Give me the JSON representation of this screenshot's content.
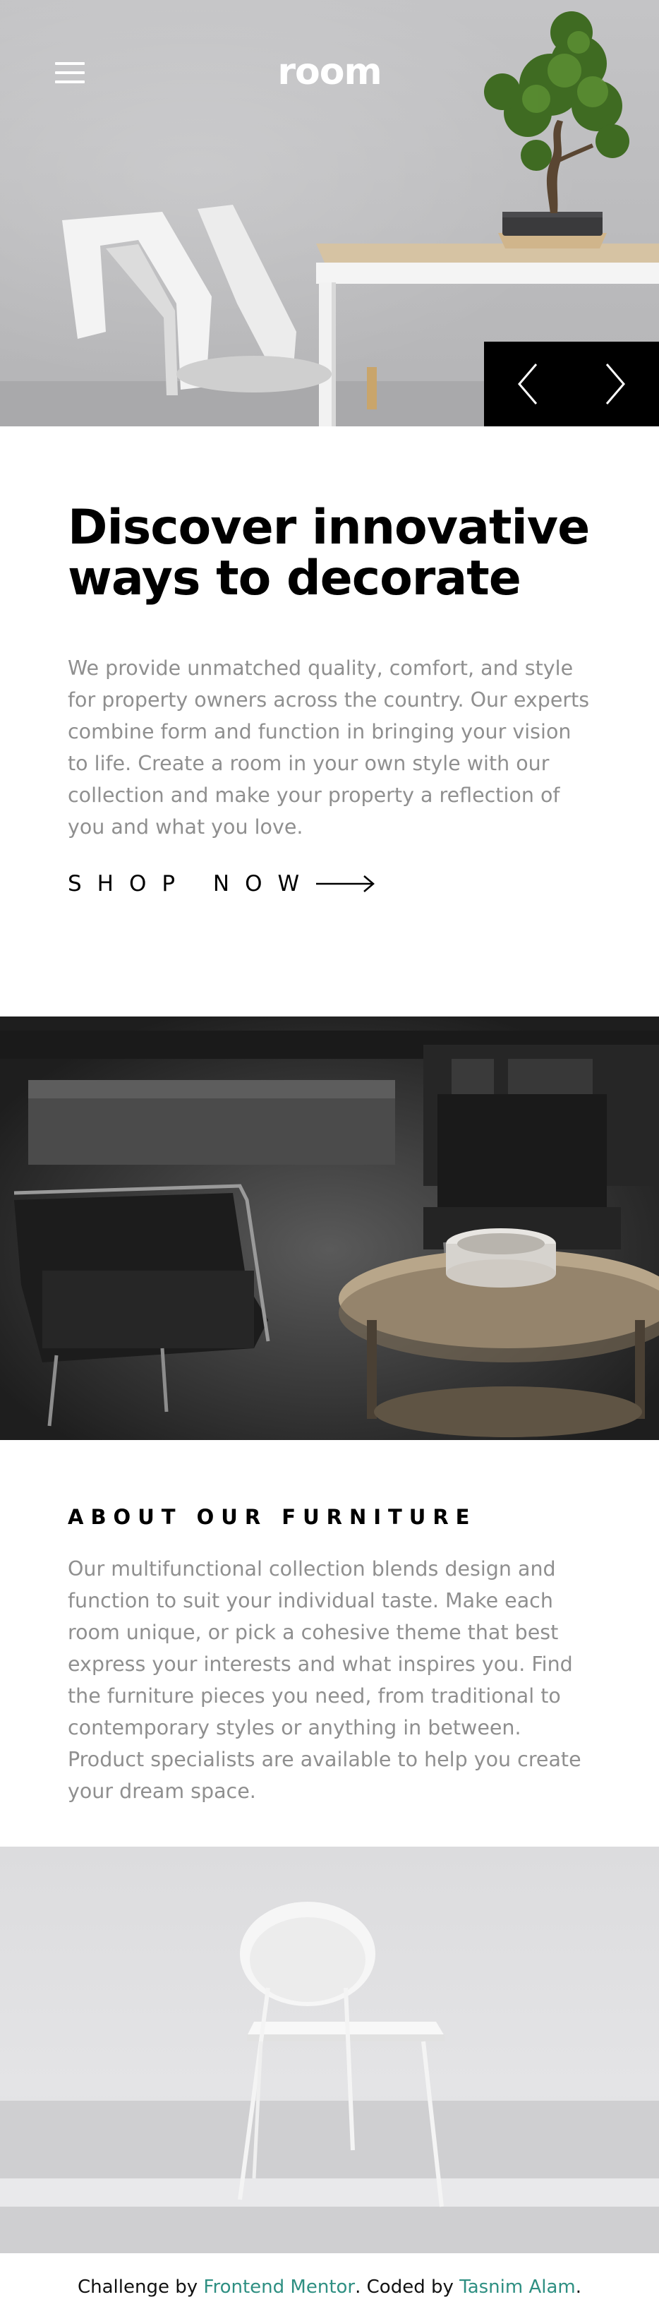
{
  "header": {
    "logo": "room",
    "menu_icon": "hamburger-icon",
    "prev_icon": "chevron-left-icon",
    "next_icon": "chevron-right-icon"
  },
  "intro": {
    "title": "Discover innovative ways to decorate",
    "body": "We provide unmatched quality, comfort, and style for property owners across the country. Our experts combine form and function in bringing your vision to life. Create a room in your own style with our collection and make your property a reflection of you and what you love.",
    "cta_label": "SHOP NOW",
    "cta_icon": "arrow-right-icon"
  },
  "about": {
    "title": "ABOUT OUR FURNITURE",
    "body": "Our multifunctional collection blends design and function to suit your individual taste. Make each room unique, or pick a cohesive theme that best express your interests and what inspires you. Find the furniture pieces you need, from traditional to contemporary styles or anything in between. Product specialists are available to help you create your dream space."
  },
  "footer": {
    "prefix": "Challenge by ",
    "challenge_link": "Frontend Mentor",
    "middle": ". Coded by ",
    "author_link": "Tasnim Alam",
    "suffix": "."
  },
  "colors": {
    "accent_link": "#2e8f82",
    "body_text": "#8f8f8f",
    "dark": "#000000"
  }
}
